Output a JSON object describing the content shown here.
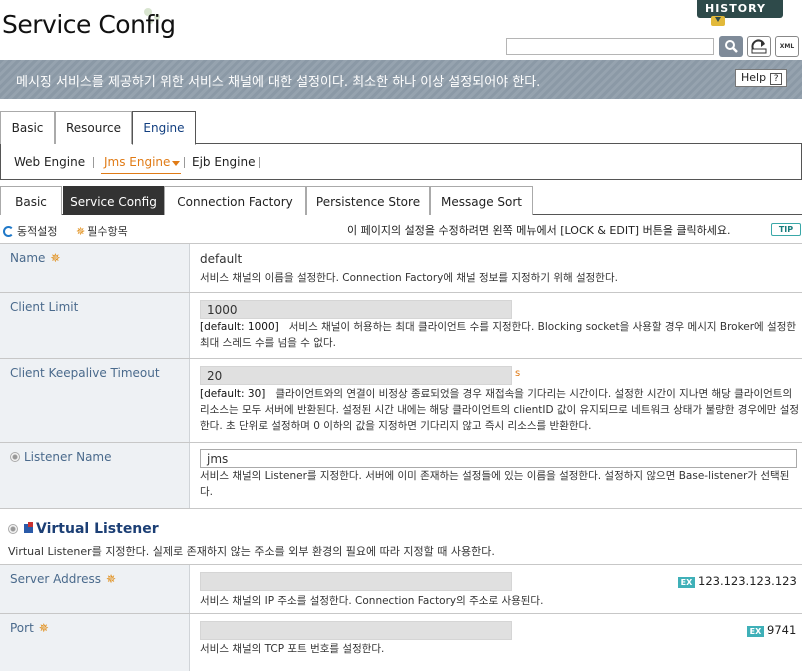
{
  "header": {
    "title": "Service Config",
    "history_label": "HISTORY",
    "xml_label": "XML"
  },
  "banner": {
    "text": "메시징 서비스를 제공하기 위한 서비스 채널에 대한 설정이다. 최소한 하나 이상 설정되어야 한다.",
    "help_label": "Help",
    "help_q": "?"
  },
  "tabs1": {
    "basic": "Basic",
    "resource": "Resource",
    "engine": "Engine"
  },
  "subnav": {
    "web": "Web Engine",
    "jms": "Jms Engine",
    "ejb": "Ejb Engine"
  },
  "tabs2": {
    "basic": "Basic",
    "service_config": "Service Config",
    "connection_factory": "Connection Factory",
    "persistence_store": "Persistence Store",
    "message_sort": "Message Sort"
  },
  "legend": {
    "dynamic": "동적설정",
    "required": "필수항목",
    "required_mark": "✵",
    "note": "이 페이지의 설정을 수정하려면 왼쪽 메뉴에서 [LOCK & EDIT] 버튼을 클릭하세요.",
    "tip": "TIP"
  },
  "fields": {
    "name": {
      "label": "Name",
      "value": "default",
      "desc": "서비스 채널의 이름을 설정한다. Connection Factory에 채널 정보를 지정하기 위해 설정한다."
    },
    "client_limit": {
      "label": "Client Limit",
      "value": "1000",
      "default": "[default: 1000]",
      "desc": "서비스 채널이 허용하는 최대 클라이언트 수를 지정한다. Blocking socket을 사용할 경우 메시지 Broker에 설정한 최대 스레드 수를 넘을 수 없다."
    },
    "keepalive": {
      "label": "Client Keepalive Timeout",
      "value": "20",
      "unit": "s",
      "default": "[default: 30]",
      "desc": "클라이언트와의 연결이 비정상 종료되었을 경우 재접속을 기다리는 시간이다. 설정한 시간이 지나면 해당 클라이언트의 리소스는 모두 서버에 반환된다. 설정된 시간 내에는 해당 클라이언트의 clientID 값이 유지되므로 네트워크 상태가 불량한 경우에만 설정한다. 초 단위로 설정하며 0 이하의 값을 지정하면 기다리지 않고 즉시 리소스를 반환한다."
    },
    "listener": {
      "label": "Listener Name",
      "value": "jms",
      "desc": "서비스 채널의 Listener를 지정한다. 서버에 이미 존재하는 설정들에 있는 이름을 설정한다. 설정하지 않으면 Base-listener가 선택된다."
    },
    "virtual_listener": {
      "title": "Virtual Listener",
      "desc": "Virtual Listener를 지정한다. 실제로 존재하지 않는 주소를 외부 환경의 필요에 따라 지정할 때 사용한다."
    },
    "server_address": {
      "label": "Server Address",
      "value": "",
      "example": "123.123.123.123",
      "ex_badge": "EX",
      "desc": "서비스 채널의 IP 주소를 설정한다. Connection Factory의 주소로 사용된다."
    },
    "port": {
      "label": "Port",
      "value": "",
      "example": "9741",
      "ex_badge": "EX",
      "desc": "서비스 채널의 TCP 포트 번호를 설정한다."
    }
  }
}
